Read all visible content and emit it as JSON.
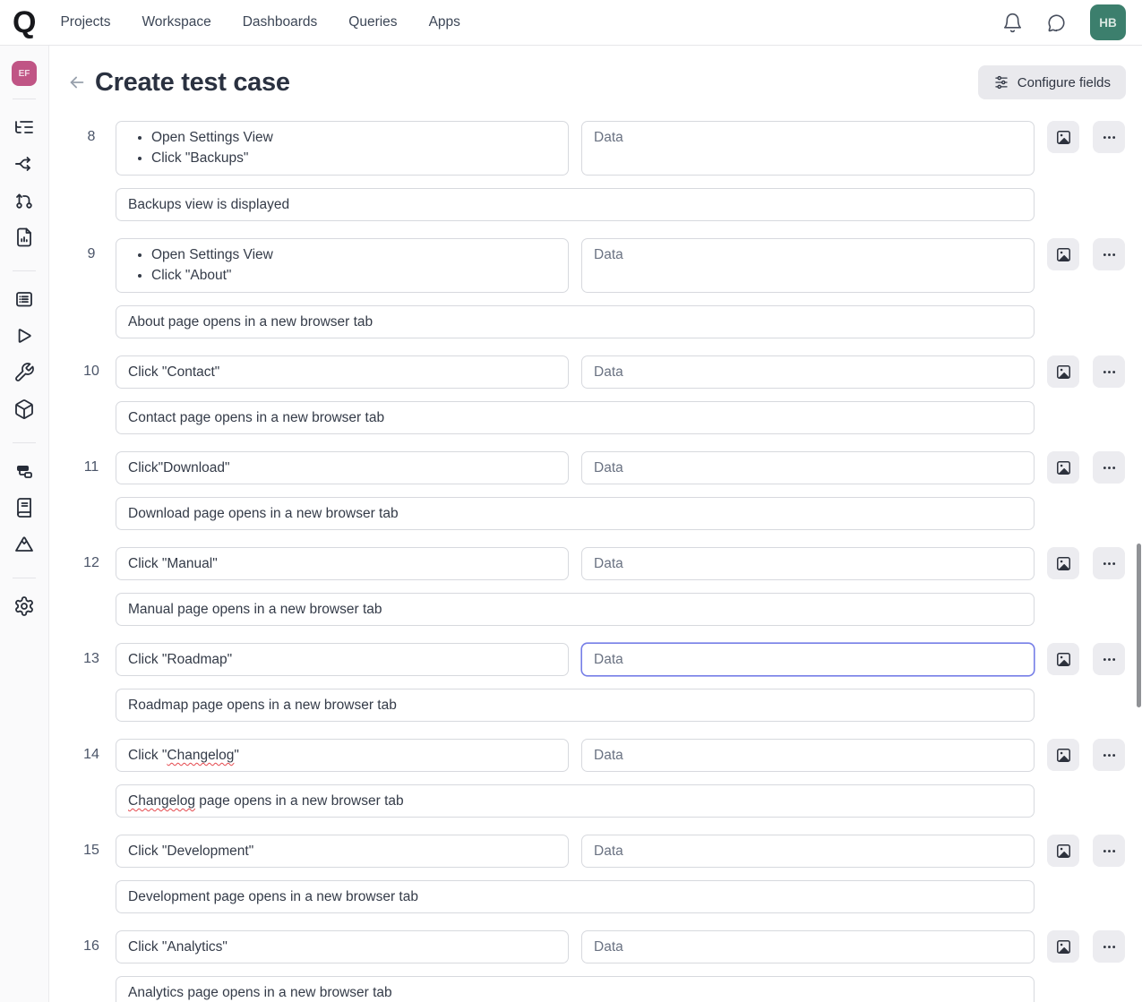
{
  "topnav": {
    "logo_letter": "Q",
    "items": [
      "Projects",
      "Workspace",
      "Dashboards",
      "Queries",
      "Apps"
    ],
    "icons": [
      "bell-icon",
      "chat-icon"
    ],
    "avatar_initials": "HB"
  },
  "sidebar": {
    "project_badge": "EF",
    "icons": [
      "tree-list-icon",
      "split-icon",
      "pull-request-icon",
      "report-file-icon",
      "test-list-icon",
      "play-icon",
      "wrench-icon",
      "cube-icon",
      "widget-icon",
      "book-icon",
      "mountain-icon",
      "gear-icon"
    ]
  },
  "header": {
    "back_icon": "arrow-left-icon",
    "title": "Create test case",
    "configure_icon": "sliders-icon",
    "configure_label": "Configure fields"
  },
  "steps": [
    {
      "number": 8,
      "action_list": [
        "Open Settings View",
        "Click \"Backups\""
      ],
      "data_placeholder": "Data",
      "expected": "Backups view is displayed"
    },
    {
      "number": 9,
      "action_list": [
        "Open Settings View",
        "Click \"About\""
      ],
      "data_placeholder": "Data",
      "expected": "About page opens in a new browser tab"
    },
    {
      "number": 10,
      "action": "Click \"Contact\"",
      "data_placeholder": "Data",
      "expected": "Contact page opens in a new browser tab"
    },
    {
      "number": 11,
      "action": "Click\"Download\"",
      "data_placeholder": "Data",
      "expected": "Download page opens in a new browser tab"
    },
    {
      "number": 12,
      "action": "Click \"Manual\"",
      "data_placeholder": "Data",
      "expected": "Manual page opens in a new browser tab"
    },
    {
      "number": 13,
      "action": "Click \"Roadmap\"",
      "data_placeholder": "Data",
      "expected": "Roadmap page opens in a new browser tab",
      "data_focused": true
    },
    {
      "number": 14,
      "action": "Click \"Changelog\"",
      "data_placeholder": "Data",
      "expected": "Changelog page opens in a new browser tab",
      "squiggle": [
        "Changelog"
      ]
    },
    {
      "number": 15,
      "action": "Click \"Development\"",
      "data_placeholder": "Data",
      "expected": "Development page opens in a new browser tab"
    },
    {
      "number": 16,
      "action": "Click \"Analytics\"",
      "data_placeholder": "Data",
      "expected": "Analytics page opens in a new browser tab"
    }
  ],
  "colors": {
    "focus_border": "#767ee7",
    "avatar_bg": "#3c7f6d",
    "project_badge_bg": "#c05585",
    "squiggle_red": "#e5484d",
    "button_bg": "#ececf0",
    "input_border": "#d7d9de"
  },
  "scrollbar_visible": true
}
